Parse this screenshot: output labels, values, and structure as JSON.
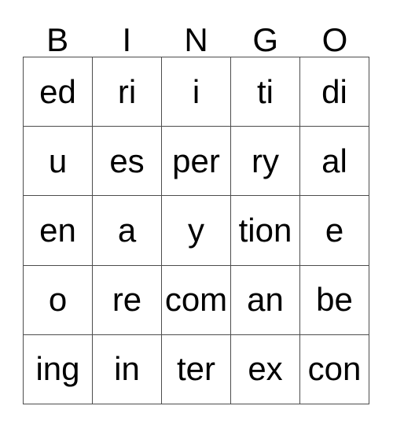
{
  "card": {
    "title": "BINGO",
    "header_letters": [
      "B",
      "I",
      "N",
      "G",
      "O"
    ],
    "colors": {
      "background": "#ffffff",
      "grid_line": "#4d4d4d",
      "text": "#000000"
    },
    "grid": {
      "columns": 5,
      "rows": 5,
      "rows_data": [
        {
          "cells": [
            "ed",
            "ri",
            "i",
            "ti",
            "di"
          ]
        },
        {
          "cells": [
            "u",
            "es",
            "per",
            "ry",
            "al"
          ]
        },
        {
          "cells": [
            "en",
            "a",
            "y",
            "tion",
            "e"
          ]
        },
        {
          "cells": [
            "o",
            "re",
            "com",
            "an",
            "be"
          ]
        },
        {
          "cells": [
            "ing",
            "in",
            "ter",
            "ex",
            "con"
          ]
        }
      ]
    }
  }
}
